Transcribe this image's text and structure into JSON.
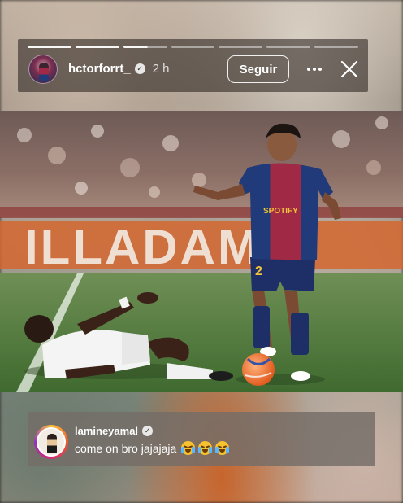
{
  "story": {
    "username": "hctorforrt_",
    "time": "2 h",
    "follow_label": "Seguir",
    "progress_segments": [
      1,
      1,
      0.55,
      0,
      0,
      0,
      0
    ],
    "icons": {
      "verified": "verified-badge-icon",
      "more": "more-options-icon",
      "close": "close-icon"
    }
  },
  "photo": {
    "description_icon": "football-match-photo",
    "stadium_banner_text": "ILLADAM",
    "player_number": "2",
    "sponsor_text": "SPOTIFY"
  },
  "comment": {
    "username": "lamineyamal",
    "text": "come on bro jajajaja",
    "emoji_count": 3,
    "emoji_name": "loudly-crying-face"
  },
  "colors": {
    "header_bg": "#231c18",
    "comment_bg": "#746c68",
    "barca_blue": "#213a7a",
    "barca_red": "#a02a46",
    "pitch": "#4f7a3c"
  }
}
